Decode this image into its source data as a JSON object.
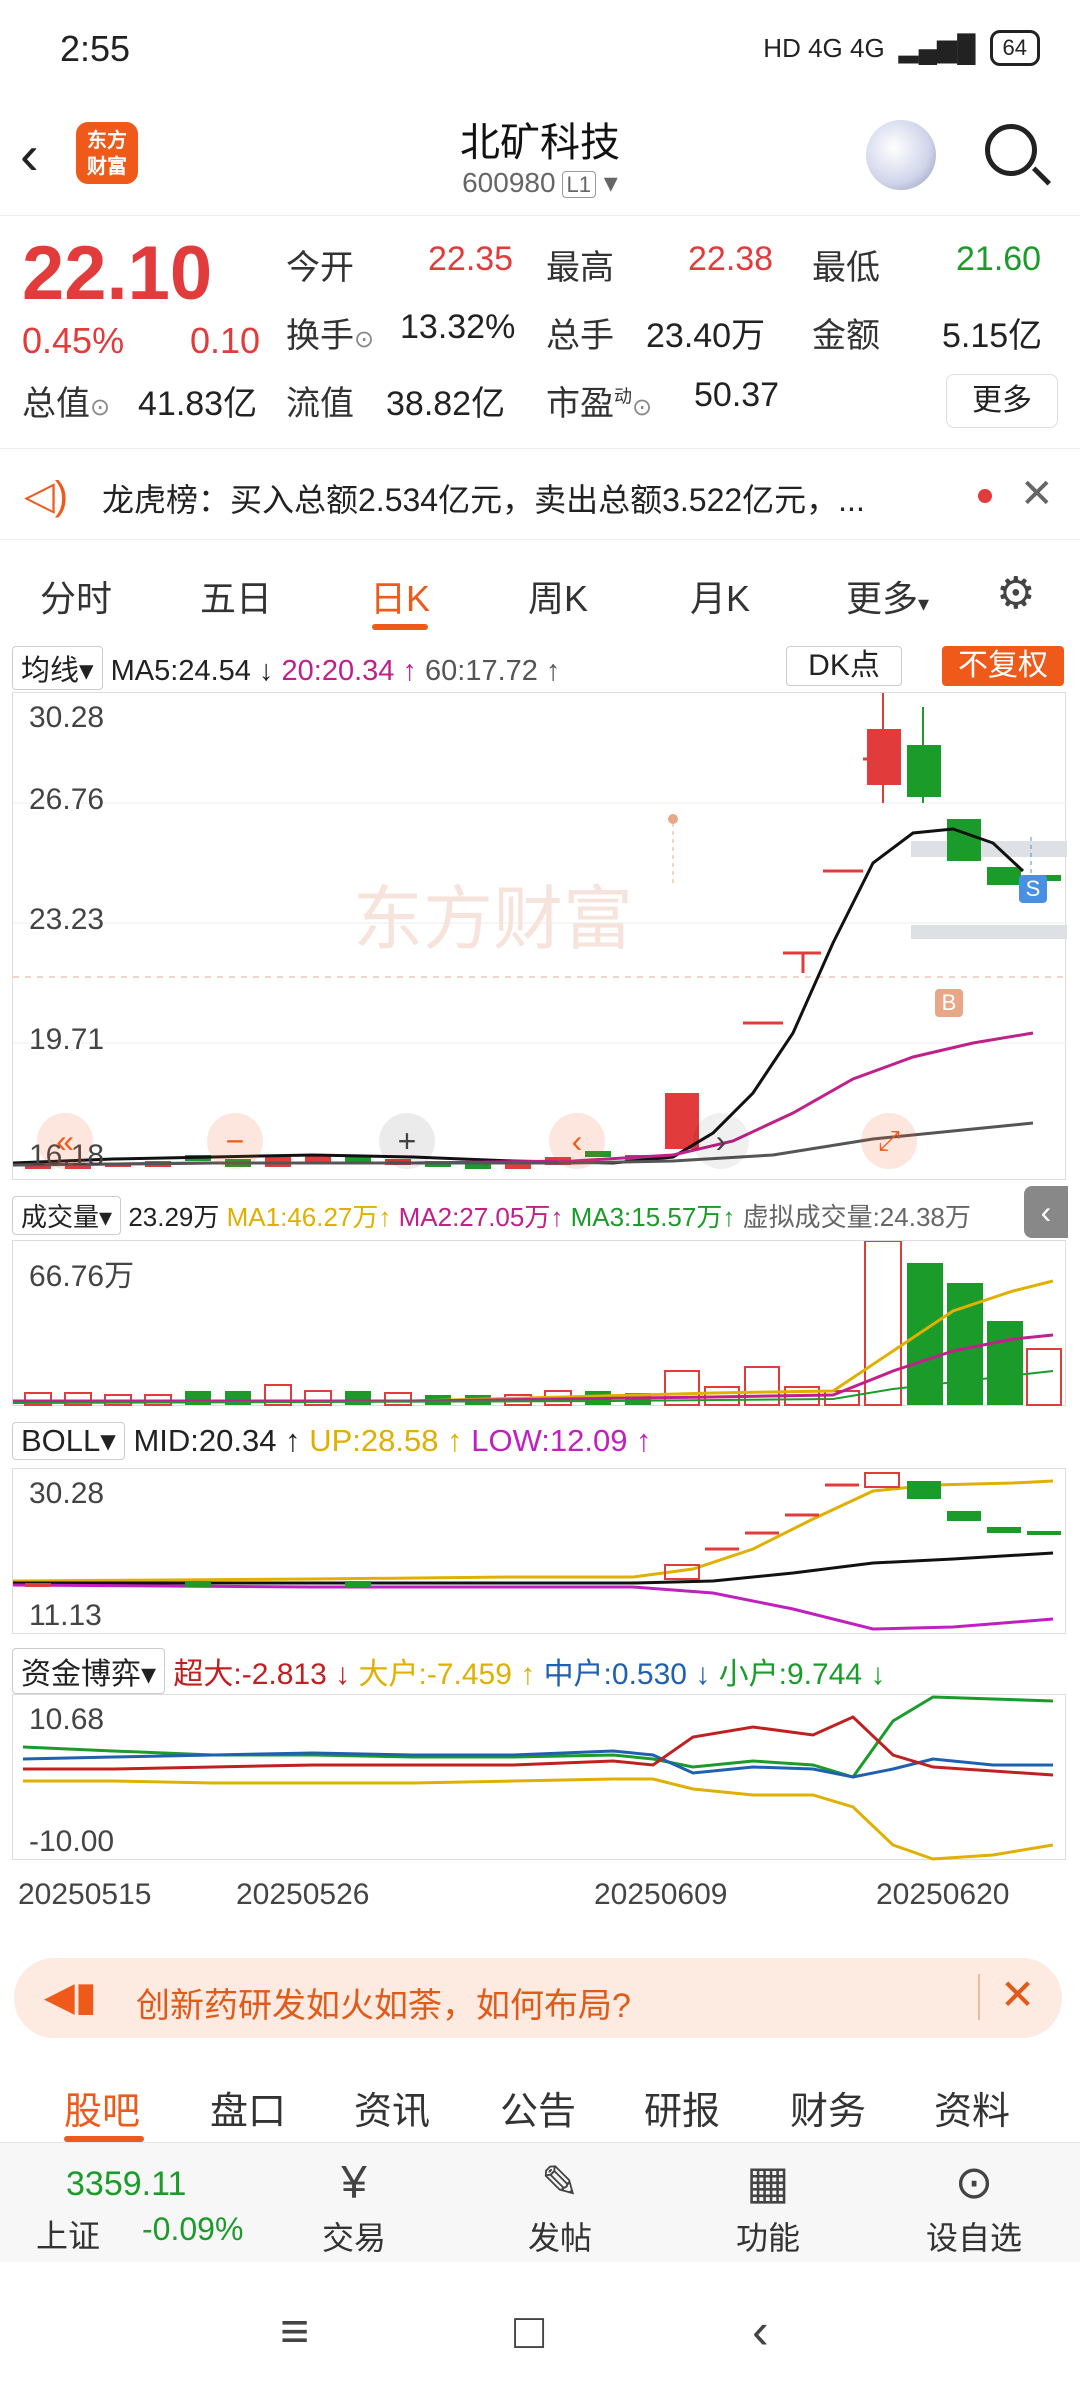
{
  "status": {
    "time": "2:55",
    "network": "HD 4G 4G",
    "battery": "64"
  },
  "header": {
    "logo_text": "东方\n财富",
    "stock_name": "北矿科技",
    "stock_code": "600980",
    "level": "L1"
  },
  "quote": {
    "price": "22.10",
    "pct": "0.45%",
    "change": "0.10",
    "open_label": "今开",
    "open": "22.35",
    "high_label": "最高",
    "high": "22.38",
    "low_label": "最低",
    "low": "21.60",
    "turnover_label": "换手",
    "turnover": "13.32%",
    "volume_label": "总手",
    "volume": "23.40万",
    "amount_label": "金额",
    "amount": "5.15亿",
    "mcap_label": "总值",
    "mcap": "41.83亿",
    "float_label": "流值",
    "float": "38.82亿",
    "pe_label": "市盈",
    "pe_sup": "动",
    "pe": "50.37",
    "more": "更多"
  },
  "notice": {
    "text": "龙虎榜：买入总额2.534亿元，卖出总额3.522亿元，..."
  },
  "tabs": [
    "分时",
    "五日",
    "日K",
    "周K",
    "月K",
    "更多"
  ],
  "active_tab": "日K",
  "ma": {
    "selector": "均线",
    "ma5": "MA5:24.54 ↓",
    "ma20": "20:20.34 ↑",
    "ma60": "60:17.72 ↑",
    "dk": "DK点",
    "fq": "不复权"
  },
  "kline": {
    "y_labels": [
      "30.28",
      "26.76",
      "23.23",
      "19.71",
      "16.18"
    ],
    "watermark": "东方财富",
    "s_marker": "S",
    "b_marker": "B"
  },
  "volume": {
    "selector": "成交量",
    "current": "23.29万",
    "ma1": "MA1:46.27万↑",
    "ma2": "MA2:27.05万↑",
    "ma3": "MA3:15.57万↑",
    "virtual": "虚拟成交量:24.38万",
    "y_max": "66.76万"
  },
  "boll": {
    "selector": "BOLL",
    "mid": "MID:20.34 ↑",
    "up": "UP:28.58 ↑",
    "low": "LOW:12.09 ↑",
    "y_top": "30.28",
    "y_bottom": "11.13"
  },
  "fund": {
    "selector": "资金博弈",
    "super": "超大:-2.813 ↓",
    "big": "大户:-7.459 ↑",
    "mid": "中户:0.530 ↓",
    "small": "小户:9.744 ↓",
    "y_top": "10.68",
    "y_bottom": "-10.00"
  },
  "dates": [
    "20250515",
    "20250526",
    "20250609",
    "20250620"
  ],
  "colors": {
    "up": "#e23b3b",
    "down": "#1a9b2a",
    "accent": "#ef5a1a",
    "ma20": "#c0208a",
    "ma60": "#555555",
    "ma5": "#111111"
  },
  "ad": {
    "text": "创新药研发如火如荼，如何布局?"
  },
  "subtabs": [
    "股吧",
    "盘口",
    "资讯",
    "公告",
    "研报",
    "财务",
    "资料"
  ],
  "bottom": {
    "index_value": "3359.11",
    "index_name": "上证",
    "index_change": "-0.09%",
    "trade": "交易",
    "post": "发帖",
    "func": "功能",
    "watch": "设自选"
  }
}
